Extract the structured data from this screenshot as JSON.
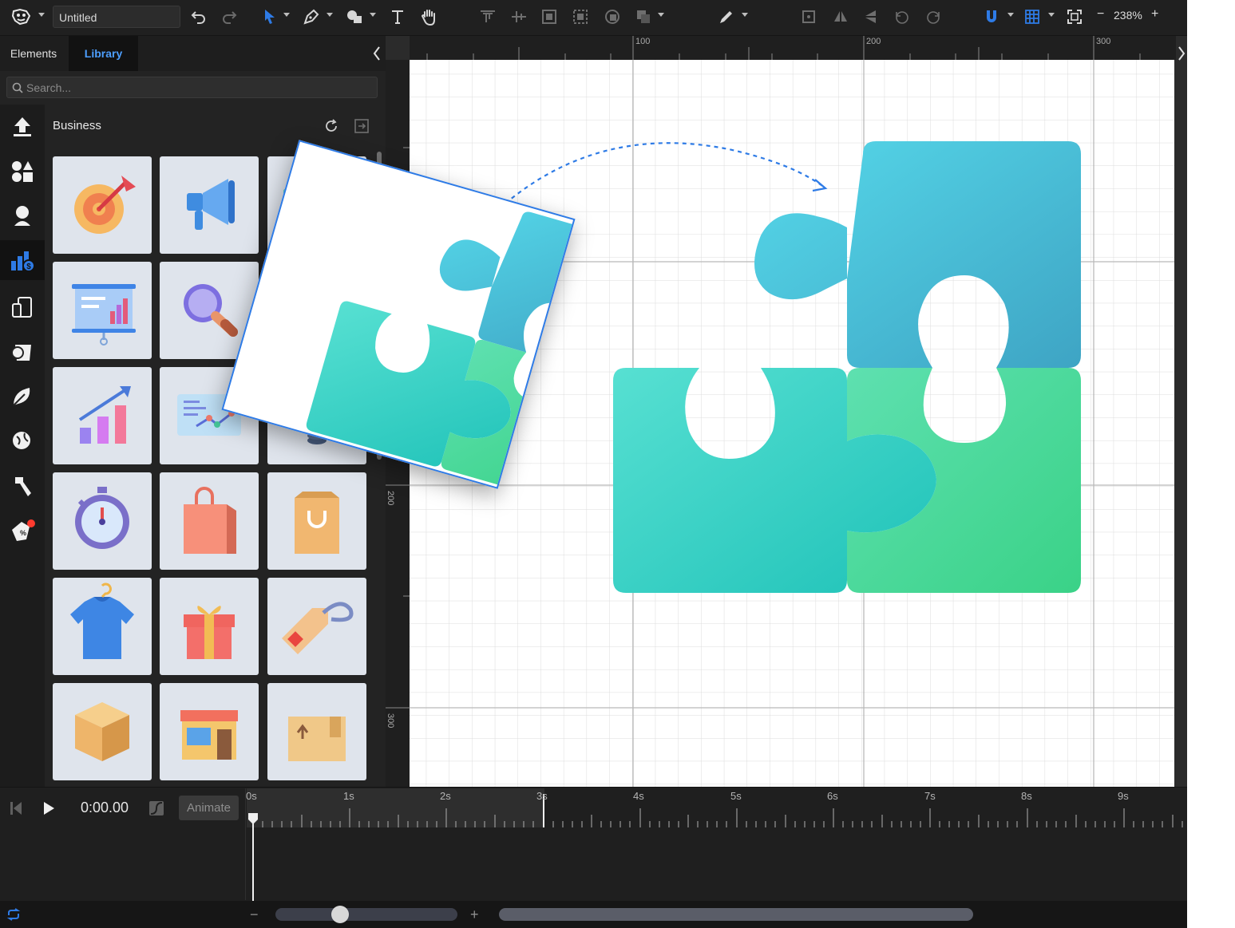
{
  "document": {
    "title": "Untitled"
  },
  "toolbar": {
    "zoom_level": "238%",
    "zoom_out": "−",
    "zoom_in": "+"
  },
  "left_panel": {
    "tabs": [
      {
        "label": "Elements",
        "active": false
      },
      {
        "label": "Library",
        "active": true
      }
    ],
    "search_placeholder": "Search...",
    "category_title": "Business",
    "rail_icons": [
      "upload-icon",
      "shapes-icon",
      "character-icon",
      "business-icon",
      "devices-icon",
      "food-icon",
      "nature-icon",
      "travel-icon",
      "tools-icon",
      "sale-icon"
    ],
    "tiles": [
      "target-icon",
      "megaphone-icon",
      "puzzle-icon",
      "presentation-icon",
      "magnifier-icon",
      "coins-icon",
      "growth-chart-icon",
      "line-graph-icon",
      "stack-icon",
      "stopwatch-icon",
      "shopping-bag-icon",
      "paper-bag-icon",
      "tshirt-icon",
      "gift-icon",
      "price-tag-icon",
      "box-icon",
      "store-icon",
      "package-icon"
    ]
  },
  "canvas": {
    "ruler_top": [
      "100",
      "200",
      "300"
    ],
    "ruler_left": [
      "200",
      "300"
    ]
  },
  "timeline": {
    "current_time": "0:00.00",
    "animate_label": "Animate",
    "ticks": [
      "0s",
      "1s",
      "2s",
      "3s",
      "4s",
      "5s",
      "6s",
      "7s",
      "8s",
      "9s"
    ]
  },
  "bottom_bar": {
    "zoom_out": "−",
    "zoom_in": "+"
  },
  "colors": {
    "accent": "#2e7be6",
    "puzzle_blue": "#4fd0e3",
    "puzzle_teal": "#2bcab9",
    "puzzle_green": "#3fd38c"
  }
}
